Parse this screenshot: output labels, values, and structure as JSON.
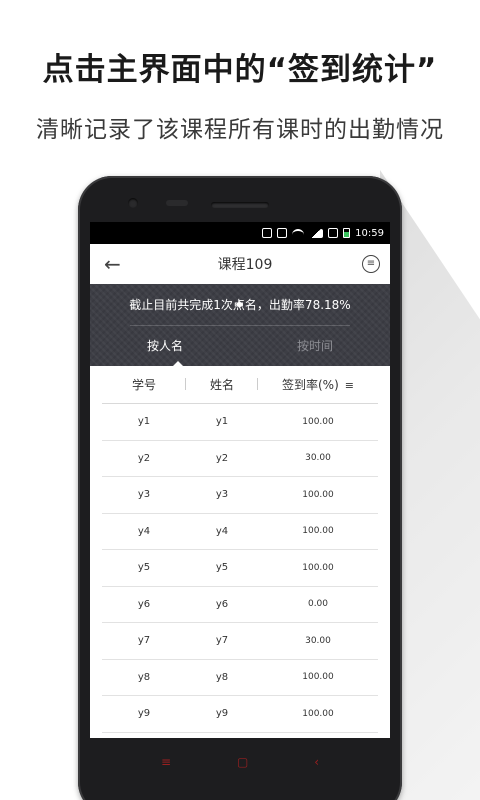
{
  "promo": {
    "title": "点击主界面中的“签到统计”",
    "subtitle": "清晰记录了该课程所有课时的出勤情况"
  },
  "status_bar": {
    "time": "10:59",
    "icons": [
      "vibrate-icon",
      "sync-icon",
      "wifi-icon",
      "signal-icon",
      "sim-icon",
      "battery-icon"
    ]
  },
  "app_bar": {
    "back_glyph": "←",
    "title": "课程109",
    "menu_glyph": "≡"
  },
  "summary": {
    "text": "截止目前共完成1次点名，出勤率78.18%"
  },
  "tabs": [
    {
      "label": "按人名",
      "active": true
    },
    {
      "label": "按时间",
      "active": false
    }
  ],
  "table": {
    "headers": [
      "学号",
      "姓名",
      "签到率(%)"
    ],
    "sort_glyph": "≡",
    "rows": [
      {
        "id": "y1",
        "name": "y1",
        "rate": "100.00"
      },
      {
        "id": "y2",
        "name": "y2",
        "rate": "30.00"
      },
      {
        "id": "y3",
        "name": "y3",
        "rate": "100.00"
      },
      {
        "id": "y4",
        "name": "y4",
        "rate": "100.00"
      },
      {
        "id": "y5",
        "name": "y5",
        "rate": "100.00"
      },
      {
        "id": "y6",
        "name": "y6",
        "rate": "0.00"
      },
      {
        "id": "y7",
        "name": "y7",
        "rate": "30.00"
      },
      {
        "id": "y8",
        "name": "y8",
        "rate": "100.00"
      },
      {
        "id": "y9",
        "name": "y9",
        "rate": "100.00"
      }
    ]
  },
  "nav": {
    "menu_glyph": "≡",
    "home_glyph": "▢",
    "back_glyph": "‹"
  },
  "colors": {
    "summary_bg": "#3d3e45",
    "nav_accent": "#9a2020",
    "battery": "#3ac25e"
  }
}
